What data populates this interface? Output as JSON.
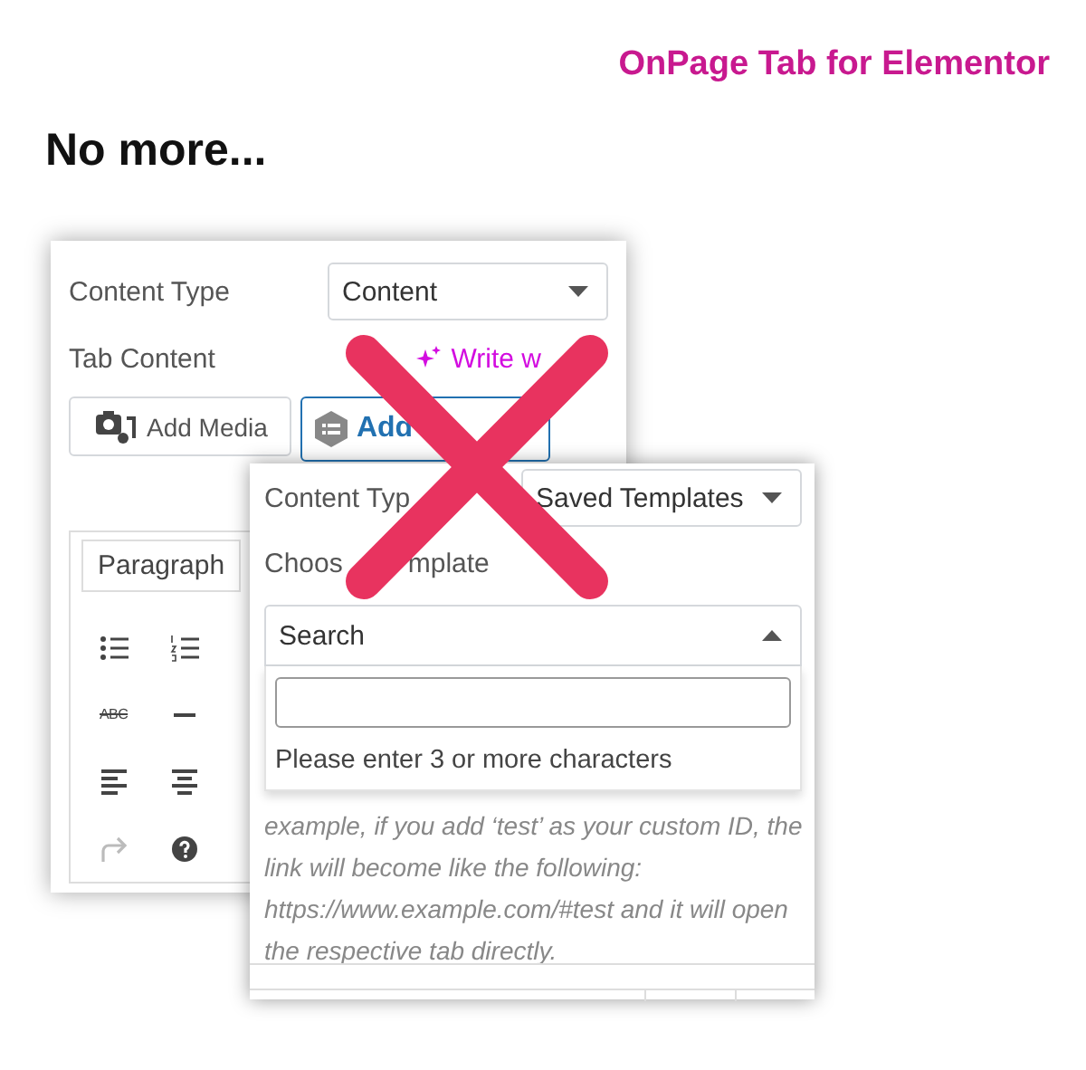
{
  "header": {
    "brand": "OnPage Tab for Elementor",
    "headline": "No more..."
  },
  "panel_back": {
    "content_type": {
      "label": "Content Type",
      "value": "Content"
    },
    "tab_content": {
      "label": "Tab Content",
      "ai_link": "Write w"
    },
    "buttons": [
      {
        "kind": "media",
        "label": "Add Media",
        "selected": false
      },
      {
        "kind": "template",
        "label": "Add",
        "selected": true
      }
    ],
    "editor": {
      "format": "Paragraph",
      "strike_label": "ABC",
      "redo_disabled": true
    }
  },
  "panel_front": {
    "content_type": {
      "label": "Content Typ",
      "value": "Saved Templates"
    },
    "choose_template": {
      "label_parts": [
        "Choos",
        "mplate"
      ]
    },
    "search_select": {
      "value": "Search",
      "expanded": true
    },
    "dropdown": {
      "message": "Please enter 3 or more characters"
    },
    "help_text_lines": [
      "example, if you add ‘test’ as your custom ID, the",
      "link will become like the following:",
      "https://www.example.com/#test and it will open",
      "the respective tab directly."
    ]
  }
}
